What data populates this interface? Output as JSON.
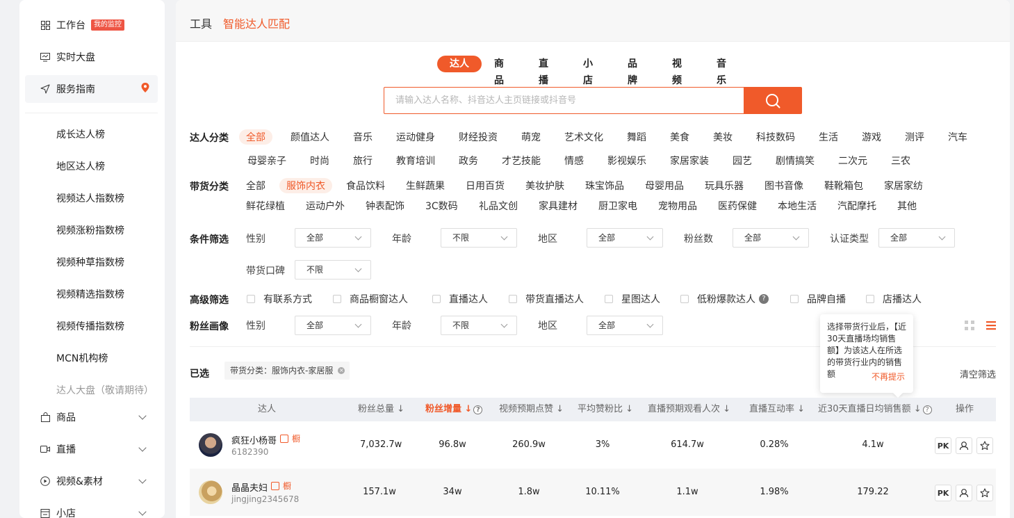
{
  "sidebar": {
    "workbench": "工作台",
    "workbench_badge": "我的监控",
    "realtime": "实时大盘",
    "service_guide": "服务指南",
    "subitems": [
      "成长达人榜",
      "地区达人榜",
      "视频达人指数榜",
      "视频涨粉指数榜",
      "视频种草指数榜",
      "视频精选指数榜",
      "视频传播指数榜",
      "MCN机构榜",
      "达人大盘（敬请期待）"
    ],
    "groups": [
      "商品",
      "直播",
      "视频&素材",
      "小店"
    ]
  },
  "breadcrumb": {
    "section": "工具",
    "page": "智能达人匹配"
  },
  "tabs": [
    "达人",
    "商品",
    "直播",
    "小店",
    "品牌",
    "视频",
    "音乐"
  ],
  "search": {
    "placeholder": "请输入达人名称、抖音达人主页链接或抖音号"
  },
  "filters": {
    "category_label": "达人分类",
    "category_row1": [
      "全部",
      "颜值达人",
      "音乐",
      "运动健身",
      "财经投资",
      "萌宠",
      "艺术文化",
      "舞蹈",
      "美食",
      "美妆",
      "科技数码",
      "生活",
      "游戏",
      "测评",
      "汽车"
    ],
    "category_row2": [
      "母婴亲子",
      "时尚",
      "旅行",
      "教育培训",
      "政务",
      "才艺技能",
      "情感",
      "影视娱乐",
      "家居家装",
      "园艺",
      "剧情搞笑",
      "二次元",
      "三农"
    ],
    "goods_label": "带货分类",
    "goods_row1": [
      "全部",
      "服饰内衣",
      "食品饮料",
      "生鲜蔬果",
      "日用百货",
      "美妆护肤",
      "珠宝饰品",
      "母婴用品",
      "玩具乐器",
      "图书音像",
      "鞋靴箱包",
      "家居家纺"
    ],
    "goods_row2": [
      "鲜花绿植",
      "运动户外",
      "钟表配饰",
      "3C数码",
      "礼品文创",
      "家具建材",
      "厨卫家电",
      "宠物用品",
      "医药保健",
      "本地生活",
      "汽配摩托",
      "其他"
    ],
    "condition_label": "条件筛选",
    "conditions": [
      {
        "label": "性别",
        "value": "全部"
      },
      {
        "label": "年龄",
        "value": "不限"
      },
      {
        "label": "地区",
        "value": "全部"
      },
      {
        "label": "粉丝数",
        "value": "全部"
      },
      {
        "label": "认证类型",
        "value": "全部"
      },
      {
        "label": "带货口碑",
        "value": "不限"
      }
    ],
    "advanced_label": "高级筛选",
    "advanced": [
      "有联系方式",
      "商品橱窗达人",
      "直播达人",
      "带货直播达人",
      "星图达人",
      "低粉爆款达人",
      "品牌自播",
      "店播达人"
    ],
    "fans_label": "粉丝画像",
    "fans": [
      {
        "label": "性别",
        "value": "全部"
      },
      {
        "label": "年龄",
        "value": "不限"
      },
      {
        "label": "地区",
        "value": "全部"
      }
    ]
  },
  "selected": {
    "label": "已选",
    "chip": "带货分类：服饰内衣-家居服",
    "clear": "清空筛选"
  },
  "tooltip": {
    "text": "选择带货行业后，【近30天直播场均销售额】为该达人在所选的带货行业内的销售额",
    "dismiss": "不再提示"
  },
  "table": {
    "headers": [
      "达人",
      "粉丝总量",
      "粉丝增量",
      "视频预期点赞",
      "平均赞粉比",
      "直播预期观看人次",
      "直播互动率",
      "近30天直播日均销售额",
      "操作"
    ],
    "rows": [
      {
        "name": "疯狂小杨哥",
        "id": "6182390",
        "fans": "7,032.7w",
        "growth": "96.8w",
        "likes": "260.9w",
        "ratio": "3%",
        "views": "614.7w",
        "interact": "0.28%",
        "sales": "4.1w",
        "tag": "橱"
      },
      {
        "name": "晶晶夫妇",
        "id": "jingjing2345678",
        "fans": "157.1w",
        "growth": "34w",
        "likes": "1.8w",
        "ratio": "10.11%",
        "views": "1.1w",
        "interact": "1.98%",
        "sales": "179.22",
        "tag": "橱"
      }
    ],
    "pk_label": "PK"
  },
  "colors": {
    "accent": "#f05a2a",
    "badge": "#ee5544"
  }
}
